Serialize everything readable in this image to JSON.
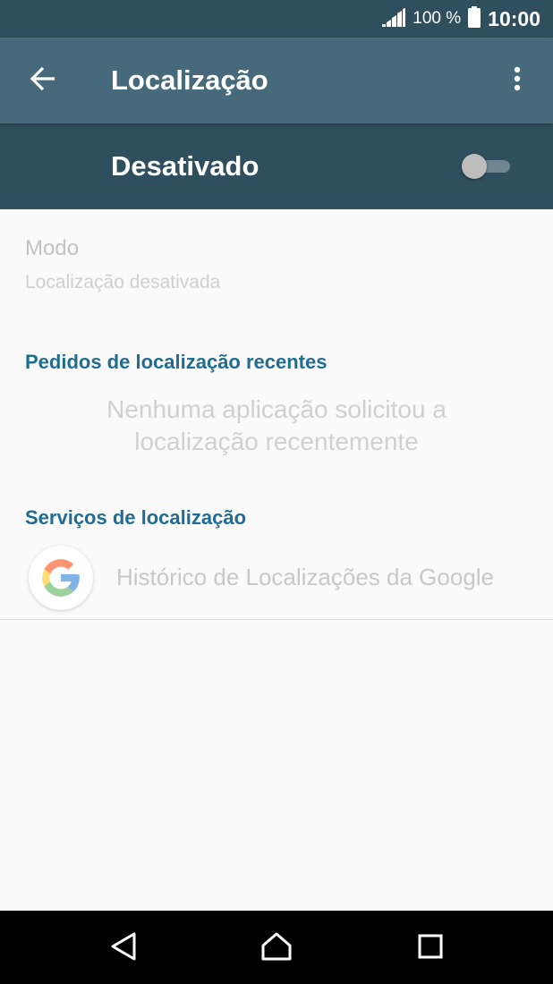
{
  "status_bar": {
    "battery_percent": "100 %",
    "time": "10:00",
    "icons": [
      "signal-icon",
      "battery-icon"
    ]
  },
  "app_bar": {
    "title": "Localização",
    "back_icon": "arrow-left-icon",
    "menu_icon": "more-vertical-icon"
  },
  "master_switch": {
    "label": "Desativado",
    "state": "off"
  },
  "mode": {
    "title": "Modo",
    "subtitle": "Localização desativada"
  },
  "recent_requests": {
    "header": "Pedidos de localização recentes",
    "empty_line_1": "Nenhuma aplicação solicitou a",
    "empty_line_2": "localização recentemente"
  },
  "services": {
    "header": "Serviços de localização",
    "items": [
      {
        "label": "Histórico de Localizações da Google",
        "icon": "google-g-icon"
      }
    ]
  },
  "colors": {
    "status_bar": "#2f4e5e",
    "app_bar": "#466a7c",
    "accent": "#1f6d93",
    "background": "#fafafa"
  },
  "nav_bar": {
    "icons": [
      "back-triangle-icon",
      "home-icon",
      "recents-square-icon"
    ]
  }
}
